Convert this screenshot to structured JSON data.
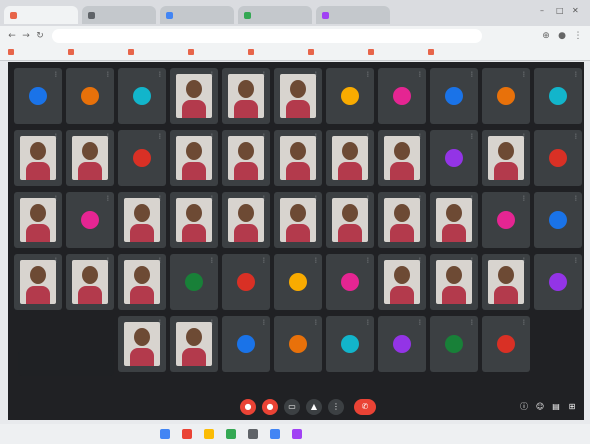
{
  "browser": {
    "tabs": [
      {
        "label": "",
        "color": "#e7654a"
      },
      {
        "label": "",
        "color": "#5f6368"
      },
      {
        "label": "",
        "color": "#4285f4"
      },
      {
        "label": "",
        "color": "#34a853"
      },
      {
        "label": "",
        "color": "#a142f4"
      }
    ],
    "window_controls": [
      "–",
      "□",
      "✕"
    ],
    "url": "",
    "bookmarks": [
      "",
      "",
      "",
      "",
      "",
      "",
      "",
      ""
    ]
  },
  "meeting": {
    "caption_text": "",
    "time": "",
    "controls": [
      {
        "icon": "mic-off-icon",
        "color": "#ea4335",
        "glyph": "●"
      },
      {
        "icon": "camera-off-icon",
        "color": "#ea4335",
        "glyph": "●"
      },
      {
        "icon": "captions-icon",
        "color": "#3c4043",
        "glyph": "▭"
      },
      {
        "icon": "present-icon",
        "color": "#3c4043",
        "glyph": "▲"
      },
      {
        "icon": "more-options-icon",
        "color": "#3c4043",
        "glyph": "⋮"
      },
      {
        "icon": "end-call-icon",
        "color": "#ea4335",
        "glyph": "✆"
      }
    ],
    "right_controls": [
      {
        "icon": "info-icon",
        "glyph": "ⓘ"
      },
      {
        "icon": "people-icon",
        "glyph": "☺"
      },
      {
        "icon": "chat-icon",
        "glyph": "▤"
      },
      {
        "icon": "activities-icon",
        "glyph": "⊞"
      }
    ]
  },
  "taskbar_icons": [
    "#4285f4",
    "#ea4335",
    "#fbbc05",
    "#34a853",
    "#5f6368",
    "#4285f4",
    "#a142f4"
  ]
}
